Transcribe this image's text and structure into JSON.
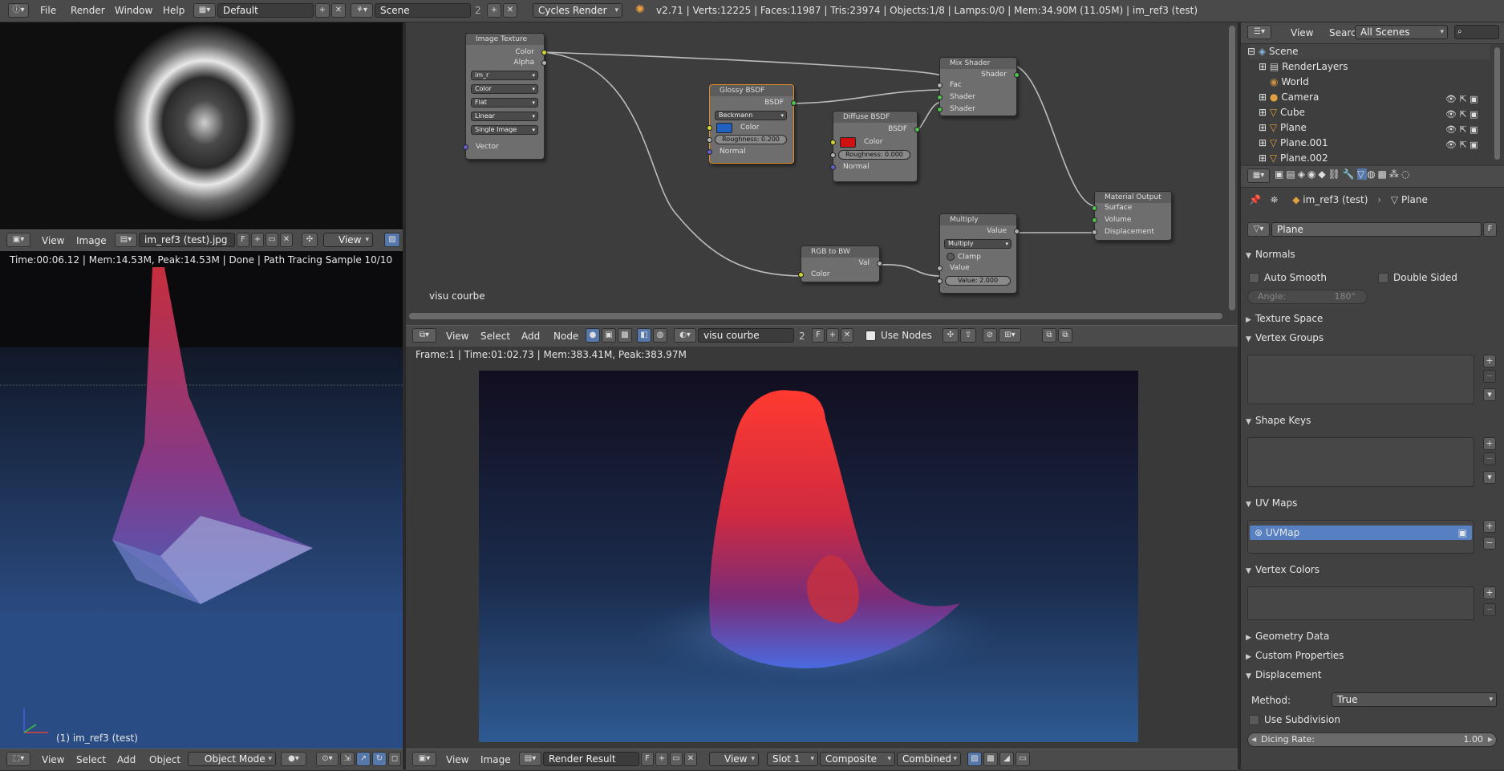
{
  "topbar": {
    "menus": [
      "File",
      "Render",
      "Window",
      "Help"
    ],
    "screen_layout": "Default",
    "scene": "Scene",
    "scene_users": "2",
    "render_engine": "Cycles Render",
    "stats": "v2.71 | Verts:12225 | Faces:11987 | Tris:23974 | Objects:1/8 | Lamps:0/0 | Mem:34.90M (11.05M) | im_ref3 (test)"
  },
  "image_editor": {
    "menus": [
      "View",
      "Image"
    ],
    "image_name": "im_ref3 (test).jpg",
    "fake_user": "F",
    "view_label": "View"
  },
  "viewport": {
    "info": "Time:00:06.12 | Mem:14.53M, Peak:14.53M | Done | Path Tracing Sample 10/10",
    "object_label": "(1) im_ref3 (test)",
    "menus": [
      "View",
      "Select",
      "Add",
      "Object"
    ],
    "mode": "Object Mode"
  },
  "node_editor": {
    "label": "visu courbe",
    "menus": [
      "View",
      "Select",
      "Add",
      "Node"
    ],
    "material": "visu courbe",
    "users": "2",
    "fake_user": "F",
    "use_nodes": "Use Nodes",
    "nodes": {
      "image_texture": {
        "title": "Image Texture",
        "out_color": "Color",
        "out_alpha": "Alpha",
        "img": "im_r",
        "opt1": "Color",
        "opt2": "Flat",
        "opt3": "Linear",
        "opt4": "Single Image",
        "in_vector": "Vector"
      },
      "glossy": {
        "title": "Glossy BSDF",
        "out": "BSDF",
        "dist": "Beckmann",
        "in_color": "Color",
        "roughness": "Roughness: 0.200",
        "normal": "Normal"
      },
      "diffuse": {
        "title": "Diffuse BSDF",
        "out": "BSDF",
        "in_color": "Color",
        "roughness": "Roughness: 0.000",
        "normal": "Normal"
      },
      "mix": {
        "title": "Mix Shader",
        "out": "Shader",
        "fac": "Fac",
        "s1": "Shader",
        "s2": "Shader"
      },
      "output": {
        "title": "Material Output",
        "surface": "Surface",
        "volume": "Volume",
        "displacement": "Displacement"
      },
      "multiply": {
        "title": "Multiply",
        "out": "Value",
        "op": "Multiply",
        "clamp": "Clamp",
        "in_value": "Value",
        "value": "Value:",
        "value_num": "2.000"
      },
      "rgbtobw": {
        "title": "RGB to BW",
        "out": "Val",
        "in": "Color"
      }
    }
  },
  "render_view": {
    "info": "Frame:1 | Time:01:02.73 | Mem:383.41M, Peak:383.97M",
    "menus": [
      "View",
      "Image"
    ],
    "image_name": "Render Result",
    "fake_user": "F",
    "view_label": "View",
    "slot": "Slot 1",
    "layer": "Composite",
    "pass": "Combined"
  },
  "outliner": {
    "menus": [
      "View",
      "Search"
    ],
    "filter": "All Scenes",
    "items": [
      {
        "label": "Scene",
        "indent": 0
      },
      {
        "label": "RenderLayers",
        "indent": 1
      },
      {
        "label": "World",
        "indent": 1
      },
      {
        "label": "Camera",
        "indent": 1
      },
      {
        "label": "Cube",
        "indent": 1
      },
      {
        "label": "Plane",
        "indent": 1
      },
      {
        "label": "Plane.001",
        "indent": 1
      },
      {
        "label": "Plane.002",
        "indent": 1
      }
    ]
  },
  "properties": {
    "breadcrumb_object": "im_ref3 (test)",
    "breadcrumb_data": "Plane",
    "mesh_name": "Plane",
    "fake_user": "F",
    "normals": "Normals",
    "auto_smooth": "Auto Smooth",
    "double_sided": "Double Sided",
    "angle_label": "Angle:",
    "angle_value": "180°",
    "texture_space": "Texture Space",
    "vertex_groups": "Vertex Groups",
    "shape_keys": "Shape Keys",
    "uv_maps": "UV Maps",
    "uv_map_item": "UVMap",
    "vertex_colors": "Vertex Colors",
    "geometry_data": "Geometry Data",
    "custom_properties": "Custom Properties",
    "displacement": "Displacement",
    "method_label": "Method:",
    "method_value": "True",
    "use_subdivision": "Use Subdivision",
    "dicing_rate_label": "Dicing Rate:",
    "dicing_rate_value": "1.00"
  }
}
